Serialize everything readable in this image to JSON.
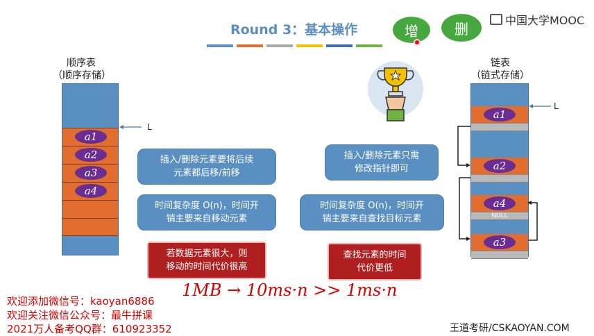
{
  "header": {
    "title": "Round 3：基本操作",
    "bubble_add": "增",
    "bubble_delete": "删",
    "logo": "中国大学MOOC",
    "strip_colors": [
      "#5a8fc2",
      "#e16e2e",
      "#a9a9a9",
      "#f2c200",
      "#3f6fb3",
      "#6cb33f"
    ]
  },
  "sequential": {
    "label_line1": "顺序表",
    "label_line2": "（顺序存储）",
    "pointer": "L",
    "elements": [
      "a1",
      "a2",
      "a3",
      "a4"
    ]
  },
  "linked": {
    "label_line1": "链表",
    "label_line2": "（链式存储）",
    "pointer": "L",
    "nodes": [
      "a1",
      "a2",
      "a4",
      "a3"
    ],
    "null_label": "NULL"
  },
  "callouts": {
    "seq_insert_line1": "插入/删除元素要将后续",
    "seq_insert_line2": "元素都后移/前移",
    "seq_time_line1": "时间复杂度 O(n)，时间开",
    "seq_time_line2": "销主要来自移动元素",
    "seq_red_line1": "若数据元素很大，则",
    "seq_red_line2": "移动的时间代价很高",
    "link_insert_line1": "插入/删除元素只需",
    "link_insert_line2": "修改指针即可",
    "link_time_line1": "时间复杂度 O(n)，时间开",
    "link_time_line2": "销主要来自查找目标元素",
    "link_red_line1": "查找元素的时间",
    "link_red_line2": "代价更低"
  },
  "handwriting": "1MB → 10ms·n >> 1ms·n",
  "footer": {
    "line1": "欢迎添加微信号：kaoyan6886",
    "line2": "欢迎关注微信公众号：最牛拼课",
    "line3": "2021万人备考QQ群：610923352",
    "watermark": "王道考研/CSKAOYAN.COM"
  }
}
